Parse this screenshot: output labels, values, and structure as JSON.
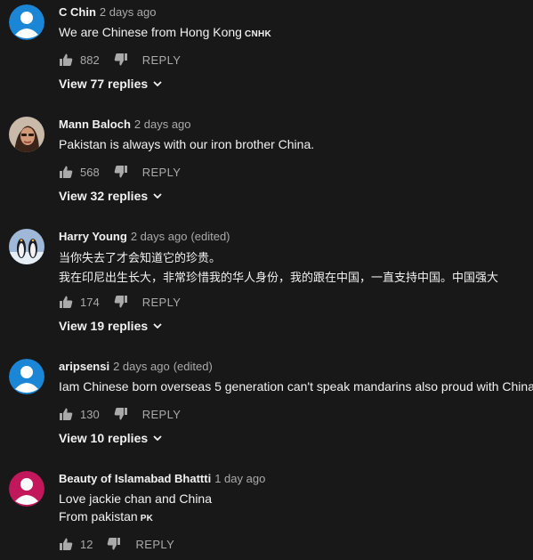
{
  "comments": [
    {
      "author": "C Chin",
      "time": "2 days ago",
      "edited": "",
      "lines": [
        "We are Chinese from Hong Kong"
      ],
      "flag": "CNHK",
      "likes": "882",
      "reply_label": "REPLY",
      "view_replies": "View 77 replies",
      "avatar": "default-avatar-blue"
    },
    {
      "author": "Mann Baloch",
      "time": "2 days ago",
      "edited": "",
      "lines": [
        "Pakistan is always with our iron brother China."
      ],
      "flag": "",
      "likes": "568",
      "reply_label": "REPLY",
      "view_replies": "View 32 replies",
      "avatar": "photo-avatar-person"
    },
    {
      "author": "Harry Young",
      "time": "2 days ago",
      "edited": "(edited)",
      "lines": [
        "当你失去了才会知道它的珍贵。",
        "我在印尼出生长大，非常珍惜我的华人身份，我的跟在中国，一直支持中国。中国强大"
      ],
      "flag": "",
      "likes": "174",
      "reply_label": "REPLY",
      "view_replies": "View 19 replies",
      "avatar": "photo-avatar-penguins"
    },
    {
      "author": "aripsensi",
      "time": "2 days ago",
      "edited": "(edited)",
      "lines": [
        "Iam Chinese born overseas 5 generation can't speak mandarins also proud with China"
      ],
      "flag": "",
      "likes": "130",
      "reply_label": "REPLY",
      "view_replies": "View 10 replies",
      "avatar": "default-avatar-blue"
    },
    {
      "author": "Beauty of Islamabad Bhattti",
      "time": "1 day ago",
      "edited": "",
      "lines": [
        "Love jackie chan and China",
        "From pakistan"
      ],
      "flag": "PK",
      "likes": "12",
      "reply_label": "REPLY",
      "view_replies": "",
      "avatar": "default-avatar-pink"
    }
  ],
  "colors": {
    "background": "#181818",
    "text": "#f1f1f1",
    "secondary_text": "#aaaaaa",
    "avatar_blue": "#1c86d6",
    "avatar_pink": "#c2185b"
  }
}
